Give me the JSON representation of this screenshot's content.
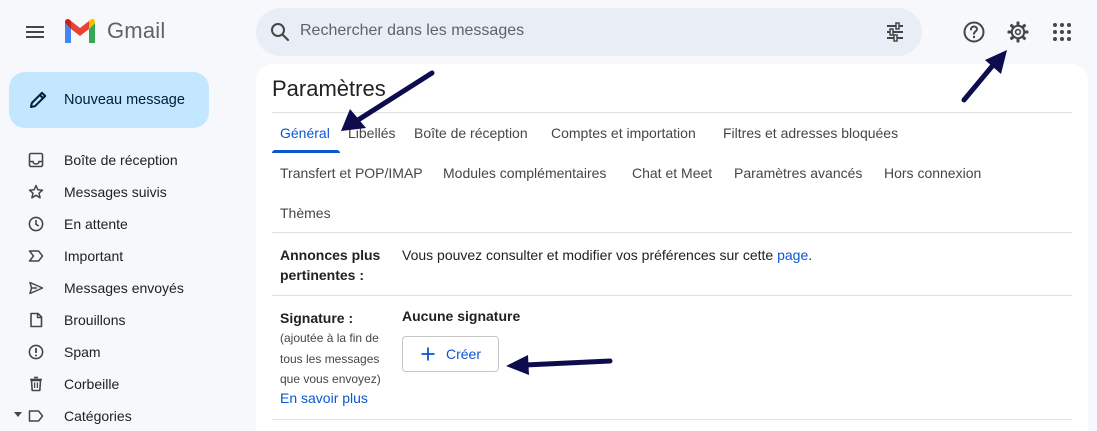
{
  "app": {
    "name": "Gmail"
  },
  "search": {
    "placeholder": "Rechercher dans les messages"
  },
  "compose": {
    "label": "Nouveau message"
  },
  "sidebar": {
    "items": [
      {
        "label": "Boîte de réception",
        "icon": "inbox-icon"
      },
      {
        "label": "Messages suivis",
        "icon": "star-icon"
      },
      {
        "label": "En attente",
        "icon": "clock-icon"
      },
      {
        "label": "Important",
        "icon": "important-icon"
      },
      {
        "label": "Messages envoyés",
        "icon": "send-icon"
      },
      {
        "label": "Brouillons",
        "icon": "draft-icon"
      },
      {
        "label": "Spam",
        "icon": "spam-icon"
      },
      {
        "label": "Corbeille",
        "icon": "trash-icon"
      },
      {
        "label": "Catégories",
        "icon": "label-icon"
      }
    ]
  },
  "settings": {
    "title": "Paramètres",
    "tabs": [
      {
        "label": "Général",
        "active": true
      },
      {
        "label": "Libellés"
      },
      {
        "label": "Boîte de réception"
      },
      {
        "label": "Comptes et importation"
      },
      {
        "label": "Filtres et adresses bloquées"
      },
      {
        "label": "Transfert et POP/IMAP"
      },
      {
        "label": "Modules complémentaires"
      },
      {
        "label": "Chat et Meet"
      },
      {
        "label": "Paramètres avancés"
      },
      {
        "label": "Hors connexion"
      },
      {
        "label": "Thèmes"
      }
    ],
    "ads": {
      "label_line1": "Annonces plus",
      "label_line2": "pertinentes :",
      "text": "Vous pouvez consulter et modifier vos préférences sur cette ",
      "link": "page",
      "text_end": "."
    },
    "signature": {
      "label": "Signature :",
      "note_lines": [
        "(ajoutée à la fin de",
        "tous les messages",
        "que vous envoyez)"
      ],
      "learn_more": "En savoir plus",
      "status": "Aucune signature",
      "create_label": "Créer"
    }
  },
  "colors": {
    "accent": "#0b57d0",
    "compose_bg": "#c2e7ff",
    "search_bg": "#e9eef6",
    "page_bg": "#f6f8fc",
    "annotation_arrow": "#0d0d4d"
  }
}
